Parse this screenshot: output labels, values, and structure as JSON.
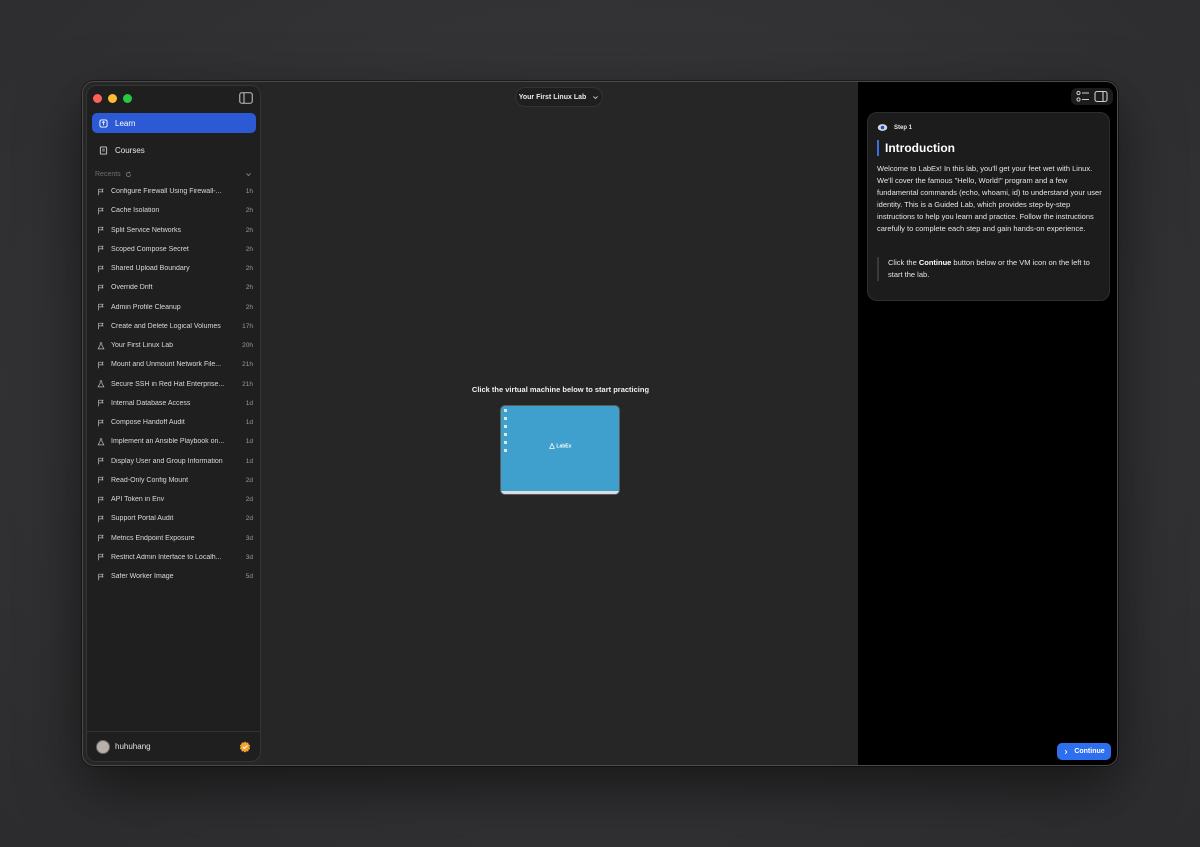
{
  "header": {
    "lab_title": "Your First Linux Lab"
  },
  "sidebar": {
    "nav": [
      {
        "label": "Learn",
        "icon": "learn-icon",
        "active": true
      },
      {
        "label": "Courses",
        "icon": "book-icon",
        "active": false
      }
    ],
    "recents_label": "Recents",
    "recents": [
      {
        "title": "Configure Firewall Using Firewall-...",
        "time": "1h",
        "icon": "flag-icon"
      },
      {
        "title": "Cache Isolation",
        "time": "2h",
        "icon": "flag-icon"
      },
      {
        "title": "Split Service Networks",
        "time": "2h",
        "icon": "flag-icon"
      },
      {
        "title": "Scoped Compose Secret",
        "time": "2h",
        "icon": "flag-icon"
      },
      {
        "title": "Shared Upload Boundary",
        "time": "2h",
        "icon": "flag-icon"
      },
      {
        "title": "Override Drift",
        "time": "2h",
        "icon": "flag-icon"
      },
      {
        "title": "Admin Profile Cleanup",
        "time": "2h",
        "icon": "flag-icon"
      },
      {
        "title": "Create and Delete Logical Volumes",
        "time": "17h",
        "icon": "flag-icon"
      },
      {
        "title": "Your First Linux Lab",
        "time": "20h",
        "icon": "flask-icon"
      },
      {
        "title": "Mount and Unmount Network File...",
        "time": "21h",
        "icon": "flag-icon"
      },
      {
        "title": "Secure SSH in Red Hat Enterprise...",
        "time": "21h",
        "icon": "flask-icon"
      },
      {
        "title": "Internal Database Access",
        "time": "1d",
        "icon": "flag-icon"
      },
      {
        "title": "Compose Handoff Audit",
        "time": "1d",
        "icon": "flag-icon"
      },
      {
        "title": "Implement an Ansible Playbook on...",
        "time": "1d",
        "icon": "flask-icon"
      },
      {
        "title": "Display User and Group Information",
        "time": "1d",
        "icon": "flag-icon"
      },
      {
        "title": "Read-Only Config Mount",
        "time": "2d",
        "icon": "flag-icon"
      },
      {
        "title": "API Token in Env",
        "time": "2d",
        "icon": "flag-icon"
      },
      {
        "title": "Support Portal Audit",
        "time": "2d",
        "icon": "flag-icon"
      },
      {
        "title": "Metrics Endpoint Exposure",
        "time": "3d",
        "icon": "flag-icon"
      },
      {
        "title": "Restrict Admin Interface to Localh...",
        "time": "3d",
        "icon": "flag-icon"
      },
      {
        "title": "Safer Worker Image",
        "time": "5d",
        "icon": "flag-icon"
      }
    ],
    "user": {
      "name": "huhuhang"
    }
  },
  "main": {
    "vm_caption": "Click the virtual machine below to start practicing",
    "vm_logo": "LabEx"
  },
  "step": {
    "tag": "Step 1",
    "heading": "Introduction",
    "body": "Welcome to LabEx! In this lab, you'll get your feet wet with Linux. We'll cover the famous \"Hello, World!\" program and a few fundamental commands (echo, whoami, id) to understand your user identity. This is a Guided Lab, which provides step-by-step instructions to help you learn and practice. Follow the instructions carefully to complete each step and gain hands-on experience.",
    "callout_prefix": "Click the ",
    "callout_bold": "Continue",
    "callout_suffix": " button below or the VM icon on the left to start the lab."
  },
  "footer": {
    "continue_label": "Continue"
  },
  "colors": {
    "accent": "#2c5ad4",
    "button": "#2e6ff0",
    "vm_background": "#3f9fcd"
  }
}
